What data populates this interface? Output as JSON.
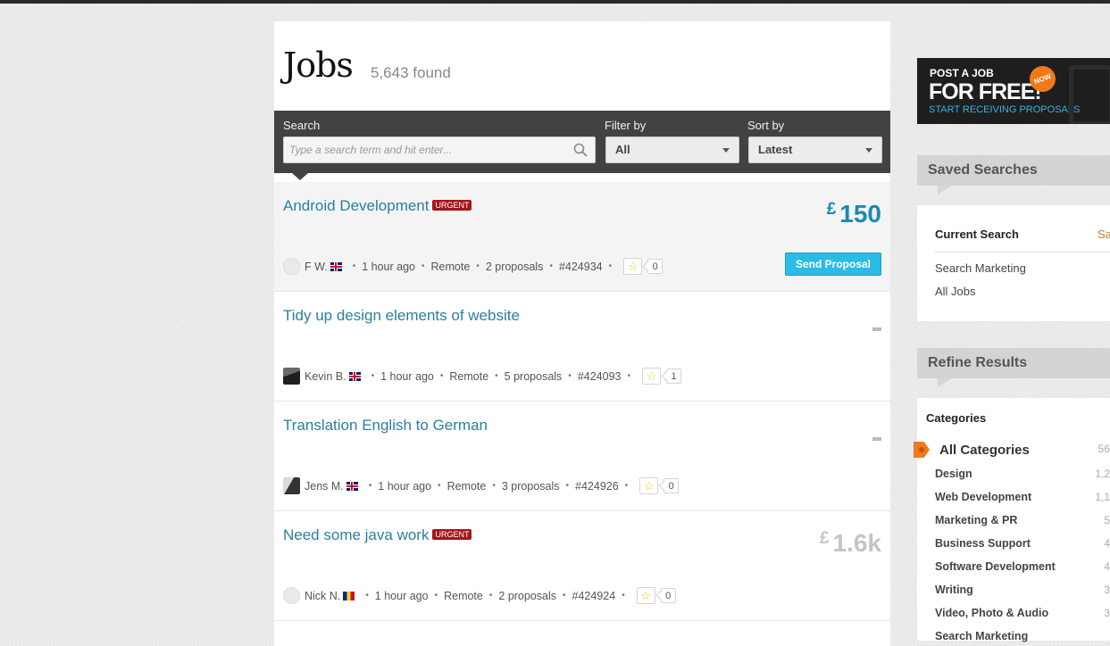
{
  "header": {
    "title": "Jobs",
    "found": "5,643 found"
  },
  "search": {
    "label": "Search",
    "placeholder": "Type a search term and hit enter...",
    "filter_label": "Filter by",
    "filter_value": "All",
    "sort_label": "Sort by",
    "sort_value": "Latest"
  },
  "jobs": [
    {
      "title": "Android Development",
      "urgent": "URGENT",
      "currency": "£",
      "price": "150",
      "price_style": "accent",
      "user": "F W.",
      "flag": "uk",
      "time": "1 hour ago",
      "location": "Remote",
      "proposals": "2 proposals",
      "id": "#424934",
      "count": "0",
      "action": "Send Proposal"
    },
    {
      "title": "Tidy up design elements of website",
      "urgent": "",
      "currency": "",
      "price": "",
      "price_style": "dash",
      "user": "Kevin B.",
      "flag": "uk",
      "time": "1 hour ago",
      "location": "Remote",
      "proposals": "5 proposals",
      "id": "#424093",
      "count": "1"
    },
    {
      "title": "Translation English to German",
      "urgent": "",
      "currency": "",
      "price": "",
      "price_style": "dash",
      "user": "Jens M.",
      "flag": "uk",
      "time": "1 hour ago",
      "location": "Remote",
      "proposals": "3 proposals",
      "id": "#424926",
      "count": "0"
    },
    {
      "title": "Need some java work",
      "urgent": "URGENT",
      "currency": "£",
      "price": "1.6k",
      "price_style": "grey",
      "user": "Nick N.",
      "flag": "ro",
      "time": "1 hour ago",
      "location": "Remote",
      "proposals": "2 proposals",
      "id": "#424924",
      "count": "0"
    }
  ],
  "promo": {
    "line1": "POST A JOB",
    "line2": "FOR FREE!",
    "badge": "NOW",
    "line3": "START RECEIVING PROPOSALS"
  },
  "saved_searches": {
    "title": "Saved Searches",
    "current_label": "Current Search",
    "current_action": "Sa",
    "items": [
      "Search Marketing",
      "All Jobs"
    ]
  },
  "refine": {
    "title": "Refine Results",
    "categories_label": "Categories",
    "all": {
      "label": "All Categories",
      "count": "56"
    },
    "items": [
      {
        "label": "Design",
        "count": "1,2"
      },
      {
        "label": "Web Development",
        "count": "1,1"
      },
      {
        "label": "Marketing & PR",
        "count": "5"
      },
      {
        "label": "Business Support",
        "count": "4"
      },
      {
        "label": "Software Development",
        "count": "4"
      },
      {
        "label": "Writing",
        "count": "3"
      },
      {
        "label": "Video, Photo & Audio",
        "count": "3"
      },
      {
        "label": "Search Marketing",
        "count": ""
      }
    ]
  },
  "colors": {
    "accent": "#1d8ab0",
    "link": "#2a7fa0",
    "urgent": "#a4161a",
    "button": "#29bde6",
    "orange": "#f07a1a"
  }
}
